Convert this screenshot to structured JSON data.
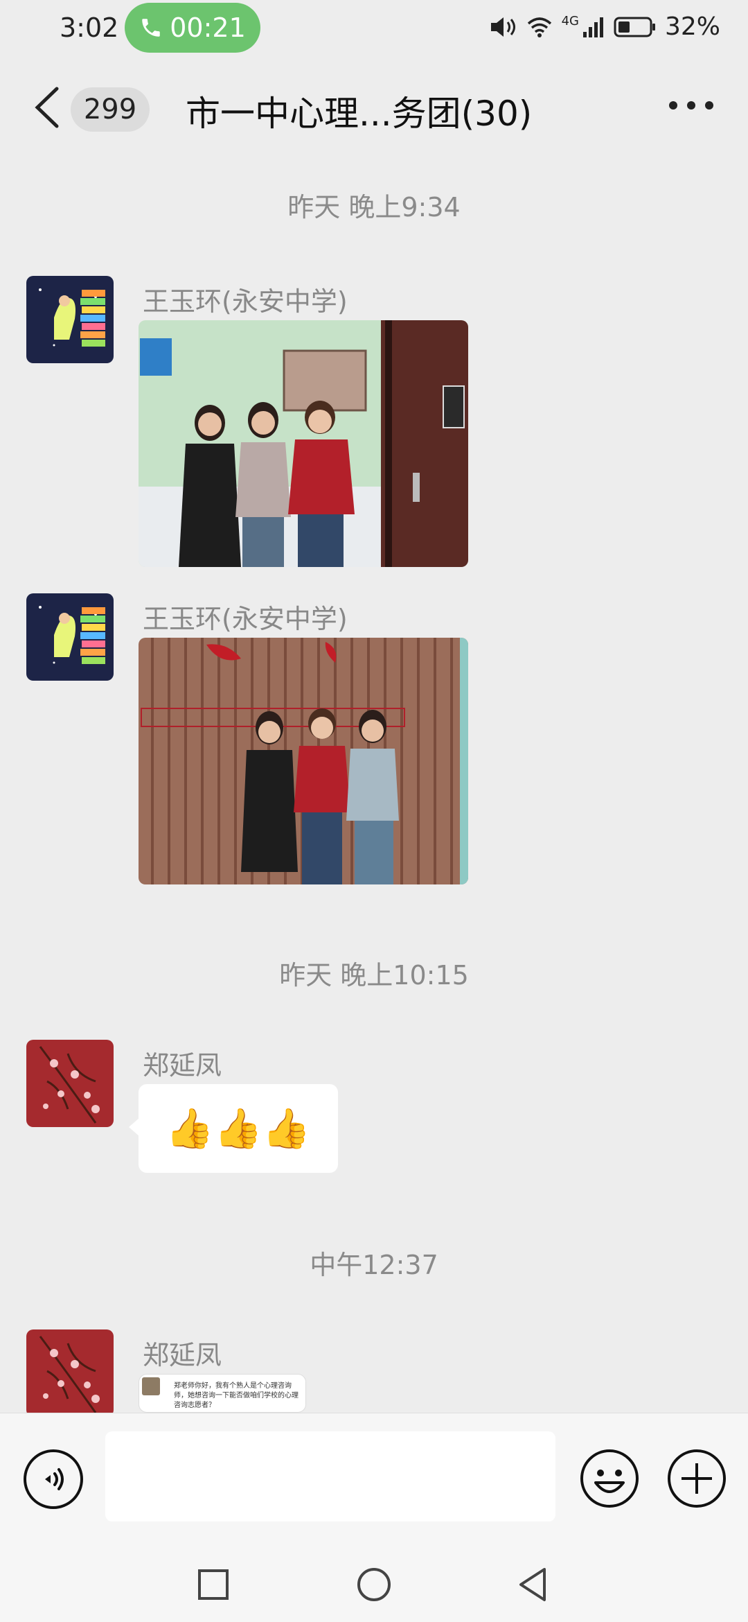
{
  "status": {
    "time": "3:02",
    "call_duration": "00:21",
    "network": "4G",
    "battery": "32%"
  },
  "header": {
    "unread_count": "299",
    "title": "市一中心理...务团(30)"
  },
  "messages": [
    {
      "timestamp": "昨天 晚上9:34"
    },
    {
      "sender": "王玉环(永安中学)",
      "type": "image",
      "image_content": "three women standing beside a door under a wall plaque"
    },
    {
      "sender": "王玉环(永安中学)",
      "type": "image",
      "image_content": "three women standing in front of a wooden slat wall with red sign"
    },
    {
      "timestamp": "昨天 晚上10:15"
    },
    {
      "sender": "郑延凤",
      "type": "emoji",
      "text": "👍👍👍"
    },
    {
      "timestamp": "中午12:37"
    },
    {
      "sender": "郑延凤",
      "type": "image_preview",
      "preview_text": "郑老师你好，我有个熟人是个心理咨询师，她想咨询一下能否做咱们学校的心理咨询志愿者？"
    }
  ],
  "input": {
    "placeholder": ""
  },
  "icons": {
    "back": "chevron-left-icon",
    "more": "more-dots-icon",
    "voice": "voice-icon",
    "emoji": "smile-icon",
    "add": "plus-circle-icon",
    "nav_recent": "square-icon",
    "nav_home": "circle-icon",
    "nav_back": "triangle-back-icon"
  },
  "colors": {
    "call_pill": "#6cc46e",
    "background": "#ededed",
    "bubble": "#ffffff"
  }
}
